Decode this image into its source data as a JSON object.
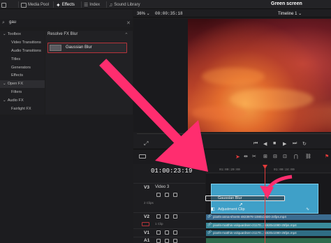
{
  "topbar": {
    "tabs": [
      {
        "label": "Media Pool",
        "icon": "media-pool-icon"
      },
      {
        "label": "Effects",
        "icon": "effects-icon"
      },
      {
        "label": "Index",
        "icon": "index-icon"
      },
      {
        "label": "Sound Library",
        "icon": "sound-library-icon"
      }
    ],
    "project_name": "Green screen"
  },
  "effects": {
    "search_value": "gau",
    "sidebar": [
      {
        "label": "Toolbox",
        "expanded": true
      },
      {
        "label": "Video Transitions"
      },
      {
        "label": "Audio Transitions"
      },
      {
        "label": "Titles"
      },
      {
        "label": "Generators"
      },
      {
        "label": "Effects"
      },
      {
        "label": "Open FX",
        "expanded": true
      },
      {
        "label": "Filters"
      },
      {
        "label": "Audio FX",
        "expanded": true
      },
      {
        "label": "Fairlight FX"
      }
    ],
    "panel_header": "Resolve FX Blur",
    "item_label": "Gaussian Blur"
  },
  "viewer": {
    "zoom": "36%",
    "timecode": "00:00:35:18",
    "timeline_name": "Timeline 1"
  },
  "timeline": {
    "timecode": "01:00:23:19",
    "ruler_labels": [
      "01:00:20:00",
      "01:00:24:00"
    ],
    "tracks": [
      {
        "id": "V3",
        "name": "Video 3",
        "sub": ""
      },
      {
        "id": "",
        "name": "",
        "sub": "2 Clips"
      },
      {
        "id": "V2",
        "name": "",
        "sub": "1 Clip"
      },
      {
        "id": "V1",
        "name": "",
        "sub": ""
      },
      {
        "id": "A1",
        "name": "",
        "sub": ""
      }
    ],
    "drag_label": "Gaussian Blur",
    "adjustment_label": "Adjustment Clip",
    "clips": [
      "pixels-anna-shvets-4823978-1080x1920-24fps.mp4",
      "pixels-matthis-volquardsen-21170...-1920x1080-25fps.mp4",
      "pixels-matthis-volquardsen-21170...-1920x1080-25fps.mp4"
    ]
  },
  "colors": {
    "accent_red": "#e23a3a",
    "arrow_pink": "#ff2d6f",
    "clip_blue": "#3fa0c8"
  }
}
